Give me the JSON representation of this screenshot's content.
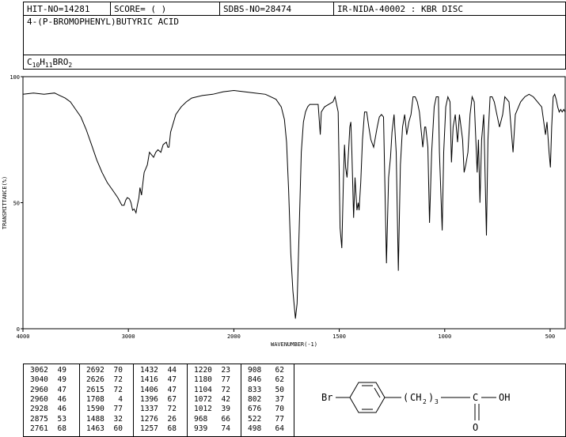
{
  "header": {
    "hit_no": "HIT-NO=14281",
    "score": "SCORE=  (   )",
    "sdbs_no": "SDBS-NO=28474",
    "ir_id": "IR-NIDA-40002 : KBR DISC"
  },
  "compound": {
    "name": "4-(P-BROMOPHENYL)BUTYRIC ACID",
    "formula_parts": [
      {
        "t": "C",
        "sub": false
      },
      {
        "t": "10",
        "sub": true
      },
      {
        "t": "H",
        "sub": false
      },
      {
        "t": "11",
        "sub": true
      },
      {
        "t": "BRO",
        "sub": false
      },
      {
        "t": "2",
        "sub": true
      }
    ]
  },
  "chart_data": {
    "type": "line",
    "xlabel": "WAVENUMBER(-1)",
    "ylabel": "TRANSMITTANCE(%)",
    "xlim": [
      4000,
      400
    ],
    "ylim": [
      0,
      100
    ],
    "x_ticks": [
      4000,
      3000,
      2000,
      1500,
      1000,
      500
    ],
    "y_ticks": [
      0,
      50,
      100
    ],
    "series": [
      {
        "points": [
          [
            4000,
            93
          ],
          [
            3900,
            93.5
          ],
          [
            3800,
            93
          ],
          [
            3700,
            93.5
          ],
          [
            3650,
            92.5
          ],
          [
            3600,
            91.5
          ],
          [
            3550,
            90
          ],
          [
            3500,
            87
          ],
          [
            3450,
            84
          ],
          [
            3400,
            79
          ],
          [
            3350,
            73
          ],
          [
            3300,
            67
          ],
          [
            3250,
            62
          ],
          [
            3200,
            58
          ],
          [
            3150,
            55
          ],
          [
            3100,
            52
          ],
          [
            3062,
            49
          ],
          [
            3040,
            49
          ],
          [
            3025,
            51
          ],
          [
            3010,
            52
          ],
          [
            2990,
            51.5
          ],
          [
            2975,
            50
          ],
          [
            2960,
            47
          ],
          [
            2945,
            47.5
          ],
          [
            2928,
            46
          ],
          [
            2915,
            49
          ],
          [
            2900,
            52
          ],
          [
            2890,
            56
          ],
          [
            2875,
            53
          ],
          [
            2868,
            56
          ],
          [
            2850,
            62
          ],
          [
            2820,
            65
          ],
          [
            2800,
            70
          ],
          [
            2761,
            68
          ],
          [
            2740,
            70
          ],
          [
            2720,
            71
          ],
          [
            2692,
            70
          ],
          [
            2670,
            73
          ],
          [
            2640,
            74
          ],
          [
            2626,
            72
          ],
          [
            2615,
            72
          ],
          [
            2600,
            78
          ],
          [
            2550,
            85
          ],
          [
            2500,
            88
          ],
          [
            2450,
            90
          ],
          [
            2400,
            91.5
          ],
          [
            2300,
            92.5
          ],
          [
            2200,
            93
          ],
          [
            2100,
            94
          ],
          [
            2000,
            94.5
          ],
          [
            1950,
            94
          ],
          [
            1900,
            93.5
          ],
          [
            1850,
            93
          ],
          [
            1800,
            91
          ],
          [
            1775,
            88
          ],
          [
            1760,
            83
          ],
          [
            1750,
            74
          ],
          [
            1740,
            55
          ],
          [
            1730,
            30
          ],
          [
            1720,
            15
          ],
          [
            1708,
            4
          ],
          [
            1700,
            10
          ],
          [
            1690,
            40
          ],
          [
            1680,
            70
          ],
          [
            1670,
            82
          ],
          [
            1660,
            86
          ],
          [
            1650,
            88
          ],
          [
            1640,
            89
          ],
          [
            1620,
            89
          ],
          [
            1600,
            89
          ],
          [
            1590,
            77
          ],
          [
            1585,
            86
          ],
          [
            1570,
            88
          ],
          [
            1550,
            89
          ],
          [
            1530,
            90
          ],
          [
            1520,
            92
          ],
          [
            1505,
            86
          ],
          [
            1500,
            60
          ],
          [
            1496,
            40
          ],
          [
            1488,
            32
          ],
          [
            1480,
            60
          ],
          [
            1475,
            73
          ],
          [
            1470,
            64
          ],
          [
            1463,
            60
          ],
          [
            1455,
            72
          ],
          [
            1450,
            80
          ],
          [
            1445,
            82
          ],
          [
            1440,
            70
          ],
          [
            1432,
            44
          ],
          [
            1425,
            60
          ],
          [
            1416,
            47
          ],
          [
            1410,
            50
          ],
          [
            1406,
            47
          ],
          [
            1398,
            58
          ],
          [
            1390,
            75
          ],
          [
            1380,
            86
          ],
          [
            1370,
            86
          ],
          [
            1360,
            80
          ],
          [
            1350,
            75
          ],
          [
            1337,
            72
          ],
          [
            1320,
            80
          ],
          [
            1310,
            84
          ],
          [
            1300,
            85
          ],
          [
            1290,
            84
          ],
          [
            1276,
            26
          ],
          [
            1266,
            60
          ],
          [
            1257,
            68
          ],
          [
            1250,
            78
          ],
          [
            1240,
            85
          ],
          [
            1230,
            70
          ],
          [
            1220,
            23
          ],
          [
            1210,
            65
          ],
          [
            1200,
            80
          ],
          [
            1190,
            85
          ],
          [
            1180,
            77
          ],
          [
            1170,
            82
          ],
          [
            1160,
            85
          ],
          [
            1150,
            92
          ],
          [
            1140,
            92
          ],
          [
            1130,
            90
          ],
          [
            1120,
            86
          ],
          [
            1104,
            72
          ],
          [
            1095,
            80
          ],
          [
            1090,
            80
          ],
          [
            1080,
            72
          ],
          [
            1072,
            42
          ],
          [
            1062,
            70
          ],
          [
            1050,
            88
          ],
          [
            1040,
            92
          ],
          [
            1030,
            92
          ],
          [
            1025,
            70
          ],
          [
            1012,
            39
          ],
          [
            1005,
            70
          ],
          [
            995,
            88
          ],
          [
            985,
            92
          ],
          [
            975,
            90
          ],
          [
            968,
            66
          ],
          [
            960,
            80
          ],
          [
            950,
            85
          ],
          [
            939,
            74
          ],
          [
            930,
            85
          ],
          [
            915,
            75
          ],
          [
            908,
            62
          ],
          [
            900,
            65
          ],
          [
            890,
            70
          ],
          [
            880,
            85
          ],
          [
            870,
            92
          ],
          [
            860,
            90
          ],
          [
            846,
            62
          ],
          [
            840,
            75
          ],
          [
            833,
            50
          ],
          [
            825,
            75
          ],
          [
            815,
            85
          ],
          [
            802,
            37
          ],
          [
            795,
            75
          ],
          [
            785,
            92
          ],
          [
            775,
            92
          ],
          [
            765,
            90
          ],
          [
            755,
            86
          ],
          [
            740,
            80
          ],
          [
            725,
            85
          ],
          [
            715,
            92
          ],
          [
            705,
            91
          ],
          [
            695,
            90
          ],
          [
            676,
            70
          ],
          [
            665,
            85
          ],
          [
            650,
            88
          ],
          [
            640,
            90
          ],
          [
            620,
            92
          ],
          [
            600,
            93
          ],
          [
            580,
            92
          ],
          [
            560,
            90
          ],
          [
            540,
            88
          ],
          [
            522,
            77
          ],
          [
            515,
            82
          ],
          [
            505,
            70
          ],
          [
            498,
            64
          ],
          [
            490,
            80
          ],
          [
            480,
            92
          ],
          [
            470,
            93
          ],
          [
            460,
            91
          ],
          [
            450,
            88
          ],
          [
            440,
            86
          ],
          [
            430,
            87
          ],
          [
            420,
            86
          ],
          [
            410,
            87
          ],
          [
            400,
            86
          ]
        ]
      }
    ],
    "peak_table": [
      [
        "3062",
        "49"
      ],
      [
        "3040",
        "49"
      ],
      [
        "2960",
        "47"
      ],
      [
        "2960",
        "46"
      ],
      [
        "2928",
        "46"
      ],
      [
        "2875",
        "53"
      ],
      [
        "2761",
        "68"
      ],
      [
        "2692",
        "70"
      ],
      [
        "2626",
        "72"
      ],
      [
        "2615",
        "72"
      ],
      [
        "1708",
        "4"
      ],
      [
        "1590",
        "77"
      ],
      [
        "1488",
        "32"
      ],
      [
        "1463",
        "60"
      ],
      [
        "1432",
        "44"
      ],
      [
        "1416",
        "47"
      ],
      [
        "1406",
        "47"
      ],
      [
        "1396",
        "67"
      ],
      [
        "1337",
        "72"
      ],
      [
        "1276",
        "26"
      ],
      [
        "1257",
        "68"
      ],
      [
        "1220",
        "23"
      ],
      [
        "1180",
        "77"
      ],
      [
        "1104",
        "72"
      ],
      [
        "1072",
        "42"
      ],
      [
        "1012",
        "39"
      ],
      [
        "968",
        "66"
      ],
      [
        "939",
        "74"
      ],
      [
        "908",
        "62"
      ],
      [
        "846",
        "62"
      ],
      [
        "833",
        "50"
      ],
      [
        "802",
        "37"
      ],
      [
        "676",
        "70"
      ],
      [
        "522",
        "77"
      ],
      [
        "498",
        "64"
      ]
    ]
  },
  "structure": {
    "br": "Br",
    "chain_open": "(",
    "chain_group": "CH",
    "chain_h_sub": "2",
    "chain_close": ")",
    "chain_n_sub": "3",
    "c_label": "C",
    "oh_label": "OH",
    "o_label": "O"
  }
}
